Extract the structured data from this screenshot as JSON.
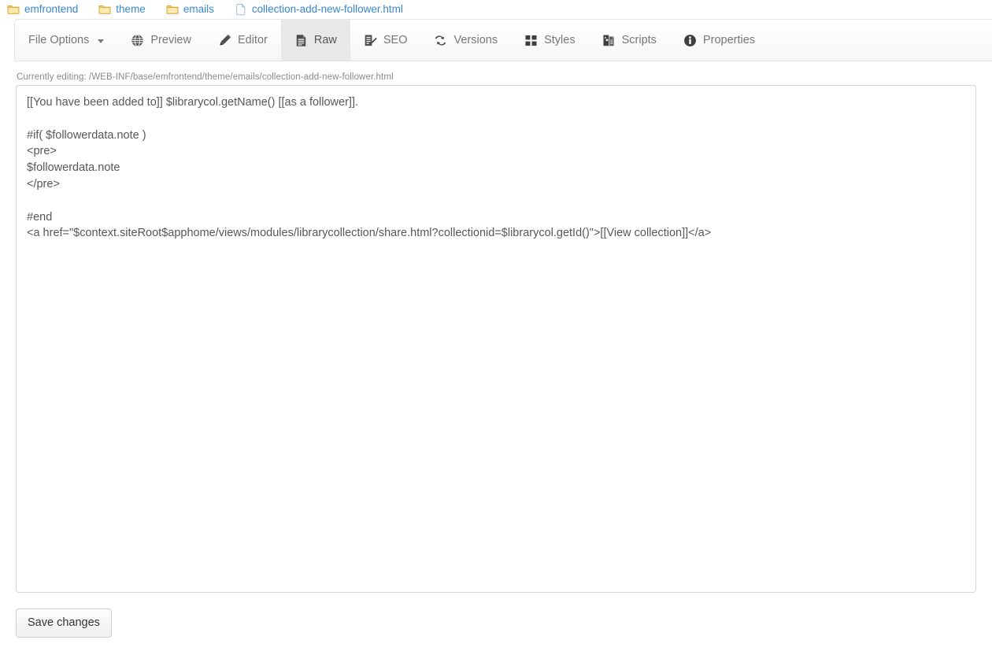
{
  "breadcrumb": {
    "items": [
      {
        "label": "emfrontend",
        "icon": "folder-icon",
        "type": "folder"
      },
      {
        "label": "theme",
        "icon": "folder-icon",
        "type": "folder"
      },
      {
        "label": "emails",
        "icon": "folder-icon",
        "type": "folder"
      },
      {
        "label": "collection-add-new-follower.html",
        "icon": "file-icon",
        "type": "file"
      }
    ],
    "link_color": "#3a87cd"
  },
  "toolbar": {
    "tabs": [
      {
        "label": "File Options",
        "icon": "caret-down-icon",
        "active": false,
        "has_caret": true
      },
      {
        "label": "Preview",
        "icon": "globe-icon",
        "active": false
      },
      {
        "label": "Editor",
        "icon": "pencil-icon",
        "active": false
      },
      {
        "label": "Raw",
        "icon": "document-lines-icon",
        "active": true
      },
      {
        "label": "SEO",
        "icon": "document-pencil-icon",
        "active": false
      },
      {
        "label": "Versions",
        "icon": "sync-arrows-icon",
        "active": false
      },
      {
        "label": "Styles",
        "icon": "four-squares-icon",
        "active": false
      },
      {
        "label": "Scripts",
        "icon": "script-file-icon",
        "active": false
      },
      {
        "label": "Properties",
        "icon": "info-circle-icon",
        "active": false
      }
    ],
    "active_tab_bg": "#e8e8e8"
  },
  "status": {
    "editing_label": "Currently editing: /WEB-INF/base/emfrontend/theme/emails/collection-add-new-follower.html"
  },
  "editor": {
    "content": "[[You have been added to]] $librarycol.getName() [[as a follower]].\n\n#if( $followerdata.note )\n<pre>\n$followerdata.note\n</pre>\n\n#end\n<a href=\"$context.siteRoot$apphome/views/modules/librarycollection/share.html?collectionid=$librarycol.getId()\">[[View collection]]</a>",
    "placeholder": ""
  },
  "actions": {
    "save_label": "Save changes"
  }
}
